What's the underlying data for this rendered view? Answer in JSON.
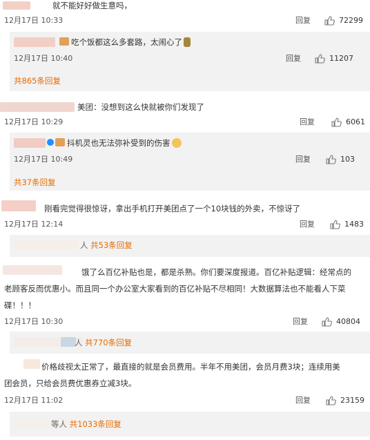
{
  "comments": [
    {
      "text": "就不能好好做生意吗，",
      "time": "12月17日 10:33",
      "reply": "回复",
      "likes": "72299",
      "nested": [
        {
          "text": "吃个饭都这么多套路，太闹心了",
          "time": "12月17日 10:40",
          "reply": "回复",
          "likes": "11207"
        }
      ],
      "more": "共865条回复"
    },
    {
      "text": "美团：没想到这么快就被你们发现了",
      "time": "12月17日 10:29",
      "reply": "回复",
      "likes": "6061",
      "nested": [
        {
          "text": "抖机灵也无法弥补受到的伤害",
          "time": "12月17日 10:49",
          "reply": "回复",
          "likes": "103"
        }
      ],
      "more": "共37条回复"
    },
    {
      "text": "刚看完觉得很惊讶，拿出手机打开美团点了一个10块钱的外卖，不惊讶了",
      "time": "12月17日 12:14",
      "reply": "回复",
      "likes": "1483",
      "more_prefix": "人",
      "more": "共53条回复"
    },
    {
      "text": "饿了么百亿补贴也是，都是杀熟。你们要深度报道。百亿补贴逻辑：经常点的老顾客反而优惠小。而且同一个办公室大家看到的百亿补贴不尽相同！大数据算法也不能看人下菜碟！！！",
      "line1": "饿了么百亿补贴也是，都是杀熟。你们要深度报道。百亿补贴逻辑：经常点的",
      "line2": "老顾客反而优惠小。而且同一个办公室大家看到的百亿补贴不尽相同！大数据算法也不能看人下菜",
      "line3": "碟！！！",
      "time": "12月17日 10:30",
      "reply": "回复",
      "likes": "40804",
      "more_prefix": "人",
      "more": "共770条回复"
    },
    {
      "line1": "价格歧视太正常了，最直接的就是会员费用。半年不用美团，会员月费3块；连续用美",
      "line2": "团会员，只给会员费优惠券立减3块。",
      "time": "12月17日 11:02",
      "reply": "回复",
      "likes": "23159",
      "more_prefix": "等人",
      "more": "共1033条回复"
    }
  ],
  "colors": {
    "accent": "#e86b00",
    "nested_bg": "#f2f2f2",
    "text": "#333333",
    "meta": "#555555"
  },
  "icons": {
    "like": "thumbs-up-icon",
    "verified": "verified-icon",
    "emoji": "emoji-icon"
  }
}
